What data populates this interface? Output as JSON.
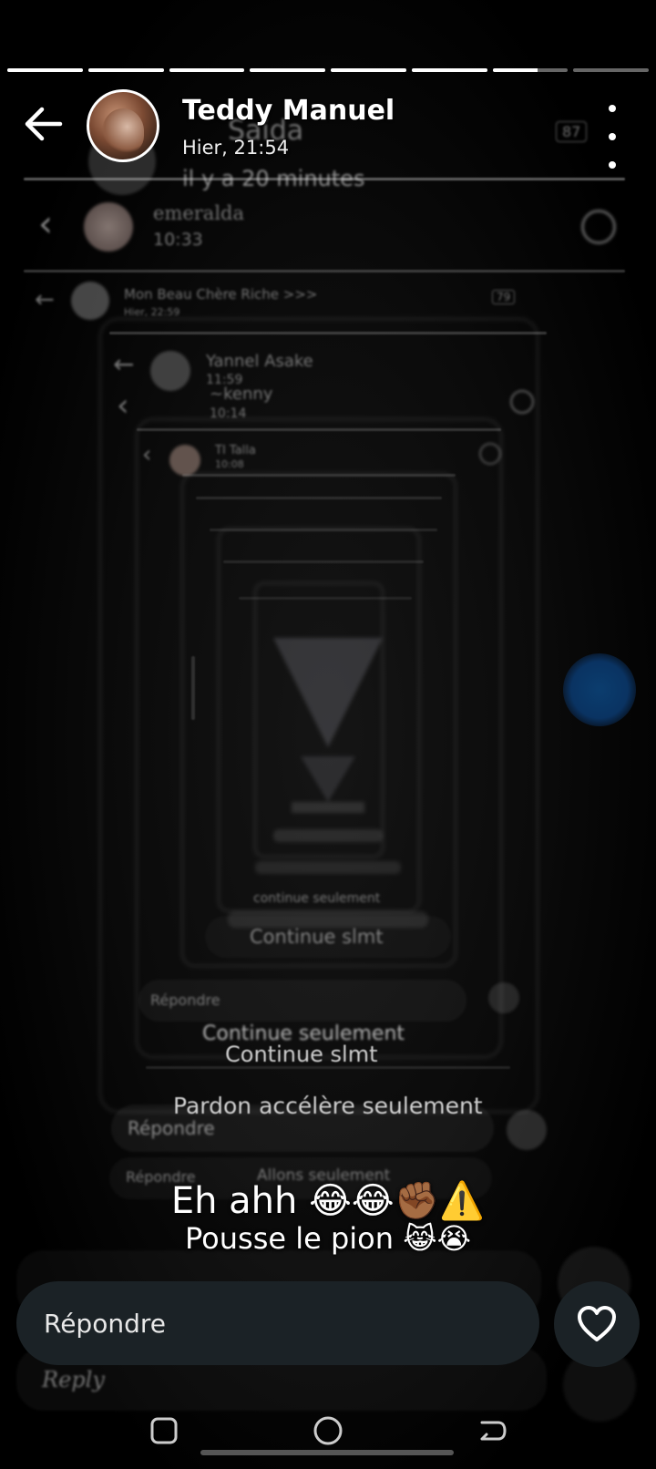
{
  "story": {
    "progress": [
      1,
      1,
      1,
      1,
      1,
      1,
      0.6,
      0
    ]
  },
  "header": {
    "name": "Teddy Manuel",
    "time": "Hier, 21:54"
  },
  "ghost": {
    "l1_time": "il y a 20 minutes",
    "l1_title": "Saida",
    "l2_name": "emeralda",
    "l2_time": "10:33",
    "l3_name": "Mon Beau Chère Riche >>>",
    "l3_time": "Hier, 22:59",
    "l3_battery": "79",
    "l4_name": "Yannel Asake",
    "l4_time": "11:59",
    "l5_name": "~kenny",
    "l5_time": "10:14",
    "l6_name": "TI Talla",
    "l6_time": "10:08",
    "l0_battery": "87",
    "r1": "continue seulement",
    "r2": "Continue slmt",
    "r3": "Répondre",
    "r4": "Continue seulement",
    "r5": "Continue slmt",
    "r6": "Pardon accélère seulement",
    "r7": "Répondre",
    "r8": "Répondre",
    "r9": "Allons seulement",
    "r10": "Reply"
  },
  "captions": {
    "big": "Eh ahh 😂😂✊🏾⚠️",
    "main": "Pousse le pion 😹😭"
  },
  "reply": {
    "placeholder": "Répondre"
  },
  "colors": {
    "accent_blue": "#0b3d6e",
    "input_bg": "#1b2226"
  }
}
